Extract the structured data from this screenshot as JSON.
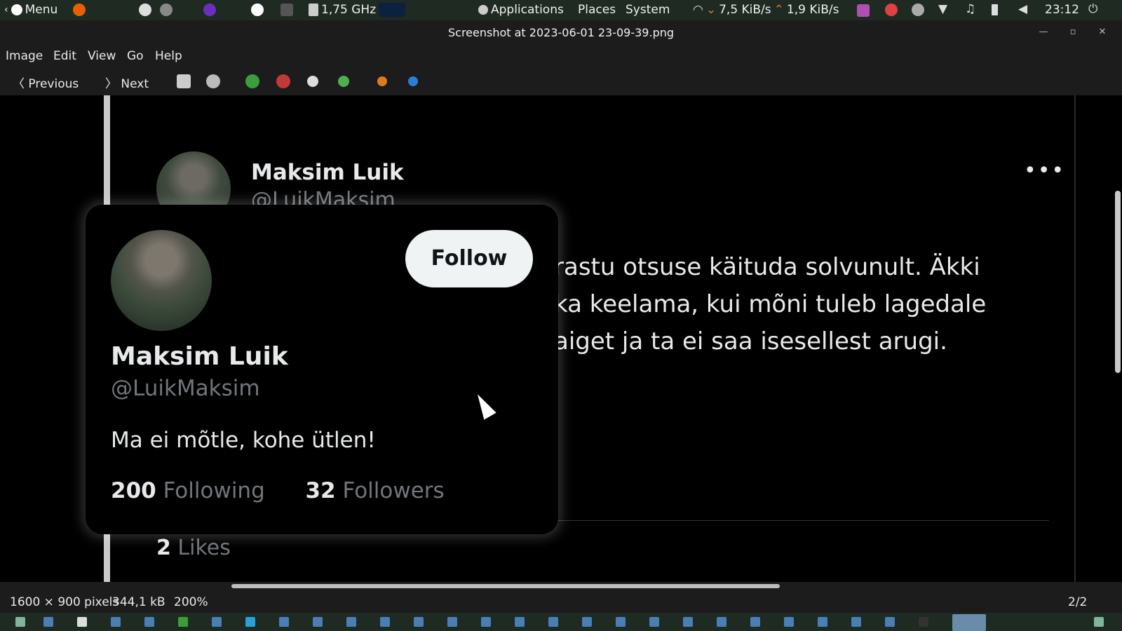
{
  "topbar": {
    "menu_label": "Menu",
    "cpu": "1,75 GHz",
    "applications": "Applications",
    "places": "Places",
    "system": "System",
    "net_down": "7,5 KiB/s",
    "net_up": "1,9 KiB/s",
    "clock": "23:12"
  },
  "window": {
    "title": "Screenshot at 2023-06-01 23-09-39.png"
  },
  "menubar": {
    "items": [
      "Image",
      "Edit",
      "View",
      "Go",
      "Help"
    ]
  },
  "toolbar": {
    "previous": "Previous",
    "next": "Next"
  },
  "tweet": {
    "name": "Maksim Luik",
    "handle": "@LuikMaksim",
    "lines": [
      "rastu otsuse käituda solvunult. Äkki",
      "ka keelama, kui mõni tuleb lagedale",
      "aiget ja ta ei saa isesellest arugi."
    ],
    "likes_count": "2",
    "likes_label": "Likes"
  },
  "card": {
    "name": "Maksim Luik",
    "handle": "@LuikMaksim",
    "follow_label": "Follow",
    "bio": "Ma ei mõtle, kohe ütlen!",
    "following_count": "200",
    "following_label": "Following",
    "followers_count": "32",
    "followers_label": "Followers"
  },
  "status": {
    "dimensions": "1600 × 900 pixels",
    "size": "344,1 kB",
    "zoom": "200%",
    "page": "2/2"
  }
}
